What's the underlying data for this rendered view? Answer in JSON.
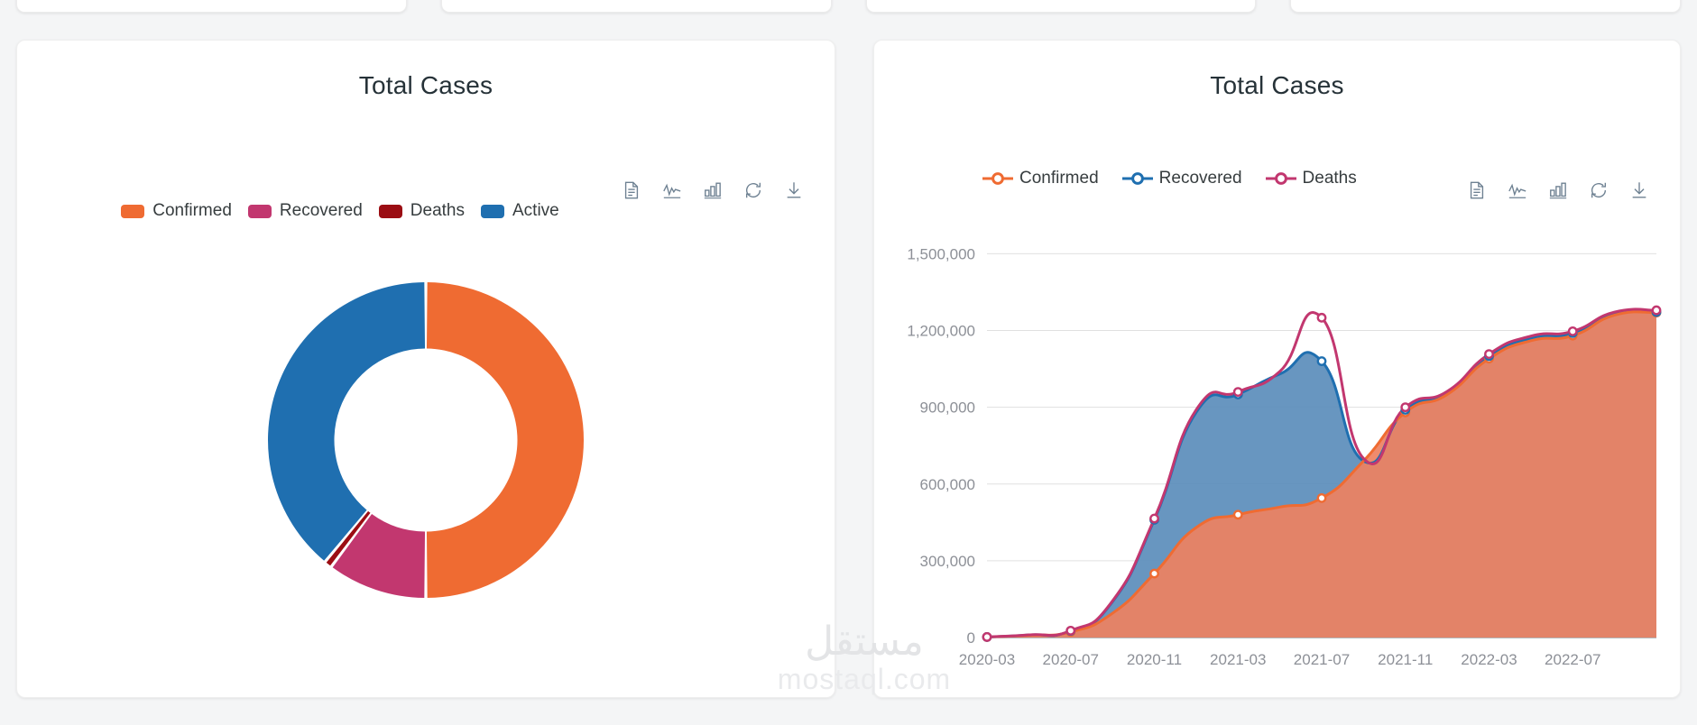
{
  "top_cards": [
    {
      "id": "card-1"
    },
    {
      "id": "card-2"
    },
    {
      "id": "card-3"
    },
    {
      "id": "card-4"
    }
  ],
  "donut_card": {
    "title": "Total Cases",
    "toolbar": [
      {
        "name": "menu-document-icon",
        "label": "Menu"
      },
      {
        "name": "line-chart-icon",
        "label": "Line chart"
      },
      {
        "name": "bar-chart-icon",
        "label": "Bar chart"
      },
      {
        "name": "reset-zoom-icon",
        "label": "Reset"
      },
      {
        "name": "download-icon",
        "label": "Download"
      }
    ]
  },
  "line_card": {
    "title": "Total Cases",
    "toolbar": [
      {
        "name": "menu-document-icon",
        "label": "Menu"
      },
      {
        "name": "line-chart-icon",
        "label": "Line chart"
      },
      {
        "name": "bar-chart-icon",
        "label": "Bar chart"
      },
      {
        "name": "reset-zoom-icon",
        "label": "Reset"
      },
      {
        "name": "download-icon",
        "label": "Download"
      }
    ]
  },
  "watermark": {
    "arabic": "مستقل",
    "latin": "mostaql.com"
  },
  "chart_data": [
    {
      "type": "pie",
      "variant": "donut",
      "title": "Total Cases",
      "legend_position": "top",
      "labels": [
        "Confirmed",
        "Recovered",
        "Deaths",
        "Active"
      ],
      "values": [
        50.0,
        10.2,
        0.8,
        39.0
      ],
      "colors": [
        "#ef6b32",
        "#c2376f",
        "#9b0d13",
        "#1f6fb0"
      ],
      "start_angle_deg": 0,
      "inner_radius_ratio": 0.58
    },
    {
      "type": "area",
      "title": "Total Cases",
      "xlabel": "",
      "ylabel": "",
      "legend_position": "top",
      "grid": true,
      "ylim": [
        0,
        1600000
      ],
      "yticks": [
        0,
        300000,
        600000,
        900000,
        1200000,
        1500000
      ],
      "ytick_labels": [
        "0",
        "300,000",
        "600,000",
        "900,000",
        "1,200,000",
        "1,500,000"
      ],
      "xticks": [
        "2020-03",
        "2020-07",
        "2020-11",
        "2021-03",
        "2021-07",
        "2021-11",
        "2022-03",
        "2022-07"
      ],
      "x": [
        "2020-03",
        "2020-05",
        "2020-07",
        "2020-09",
        "2020-11",
        "2021-01",
        "2021-03",
        "2021-05",
        "2021-07",
        "2021-08",
        "2021-09",
        "2021-11",
        "2022-01",
        "2022-03",
        "2022-05",
        "2022-07",
        "2022-09"
      ],
      "series": [
        {
          "name": "Confirmed",
          "color": "#ef6b32",
          "fill_color": "#ee8161",
          "values": [
            2000,
            9000,
            22000,
            95000,
            250000,
            430000,
            480000,
            510000,
            545000,
            690000,
            880000,
            950000,
            1090000,
            1160000,
            1180000,
            1260000,
            1270000
          ]
        },
        {
          "name": "Recovered",
          "color": "#1f6fb0",
          "fill_color": "#5b8dbb",
          "values": [
            2000,
            10000,
            26000,
            140000,
            460000,
            880000,
            950000,
            1030000,
            1080000,
            690000,
            890000,
            955000,
            1100000,
            1170000,
            1190000,
            1265000,
            1272000
          ]
        },
        {
          "name": "Deaths",
          "color": "#c2376f",
          "fill_color": "none",
          "values": [
            2200,
            10500,
            27000,
            143000,
            465000,
            890000,
            960000,
            1040000,
            1250000,
            700000,
            900000,
            962000,
            1108000,
            1178000,
            1197000,
            1272000,
            1279000
          ]
        }
      ]
    }
  ]
}
